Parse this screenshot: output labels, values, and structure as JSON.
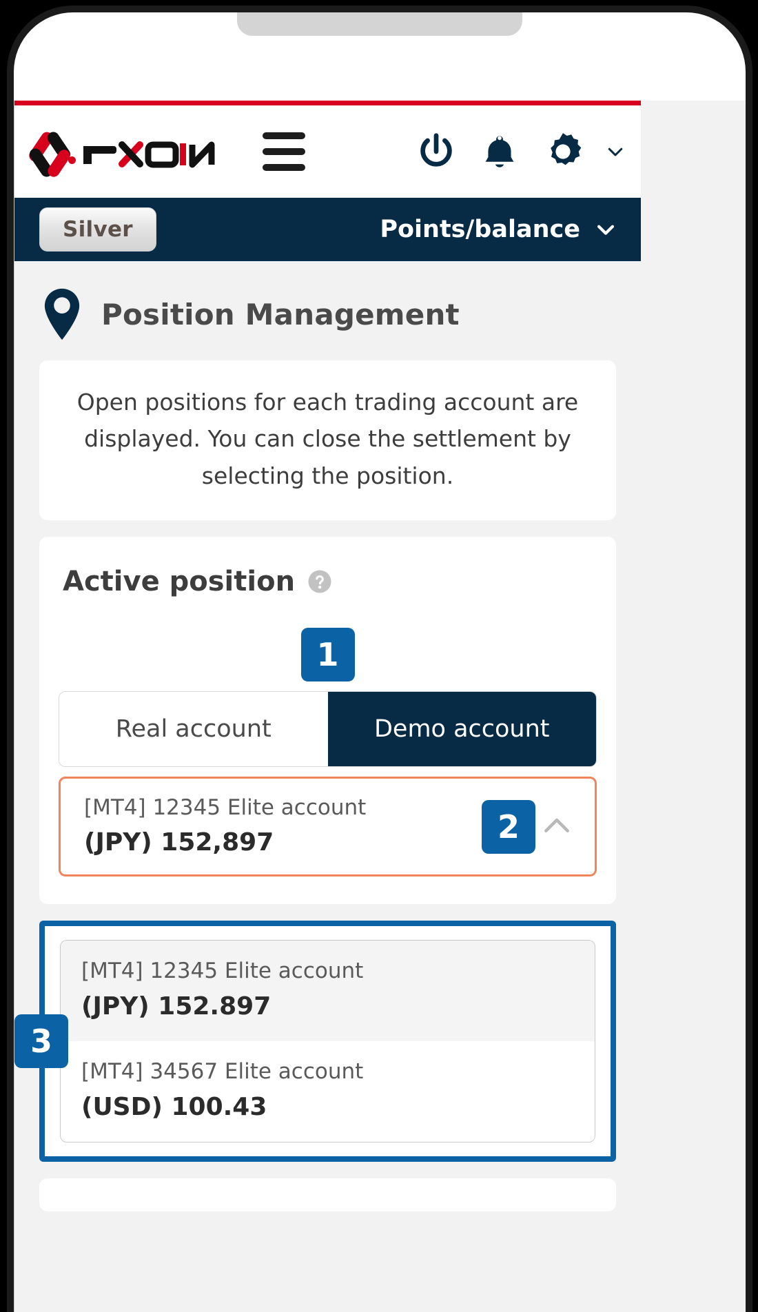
{
  "brand": {
    "logo_text": "FXON",
    "accent_red": "#d7001d",
    "navy": "#072b45",
    "step_blue": "#0b63a5",
    "selected_orange": "#f0855d"
  },
  "header": {
    "menu_icon": "hamburger-icon",
    "power_icon": "power-icon",
    "bell_icon": "bell-icon",
    "gear_icon": "gear-icon",
    "chevron_icon": "chevron-down-icon"
  },
  "rank_bar": {
    "rank_label": "Silver",
    "points_balance_label": "Points/balance",
    "chevron_icon": "chevron-down-icon"
  },
  "page": {
    "pin_icon": "map-pin-icon",
    "title": "Position Management",
    "description": "Open positions for each trading account are displayed. You can close the settlement by selecting the position."
  },
  "active_position": {
    "title": "Active position",
    "help_icon": "help-circle-icon",
    "step_badges": {
      "one": "1",
      "two": "2",
      "three": "3"
    },
    "tabs": [
      {
        "label": "Real account",
        "active": false
      },
      {
        "label": "Demo account",
        "active": true
      }
    ],
    "selected_account": {
      "name": "[MT4] 12345 Elite account",
      "amount": "(JPY) 152,897",
      "collapse_icon": "chevron-up-icon"
    },
    "dropdown_items": [
      {
        "name": "[MT4] 12345 Elite account",
        "amount": "(JPY) 152.897",
        "highlighted": true
      },
      {
        "name": "[MT4] 34567 Elite account",
        "amount": "(USD) 100.43",
        "highlighted": false
      }
    ]
  }
}
